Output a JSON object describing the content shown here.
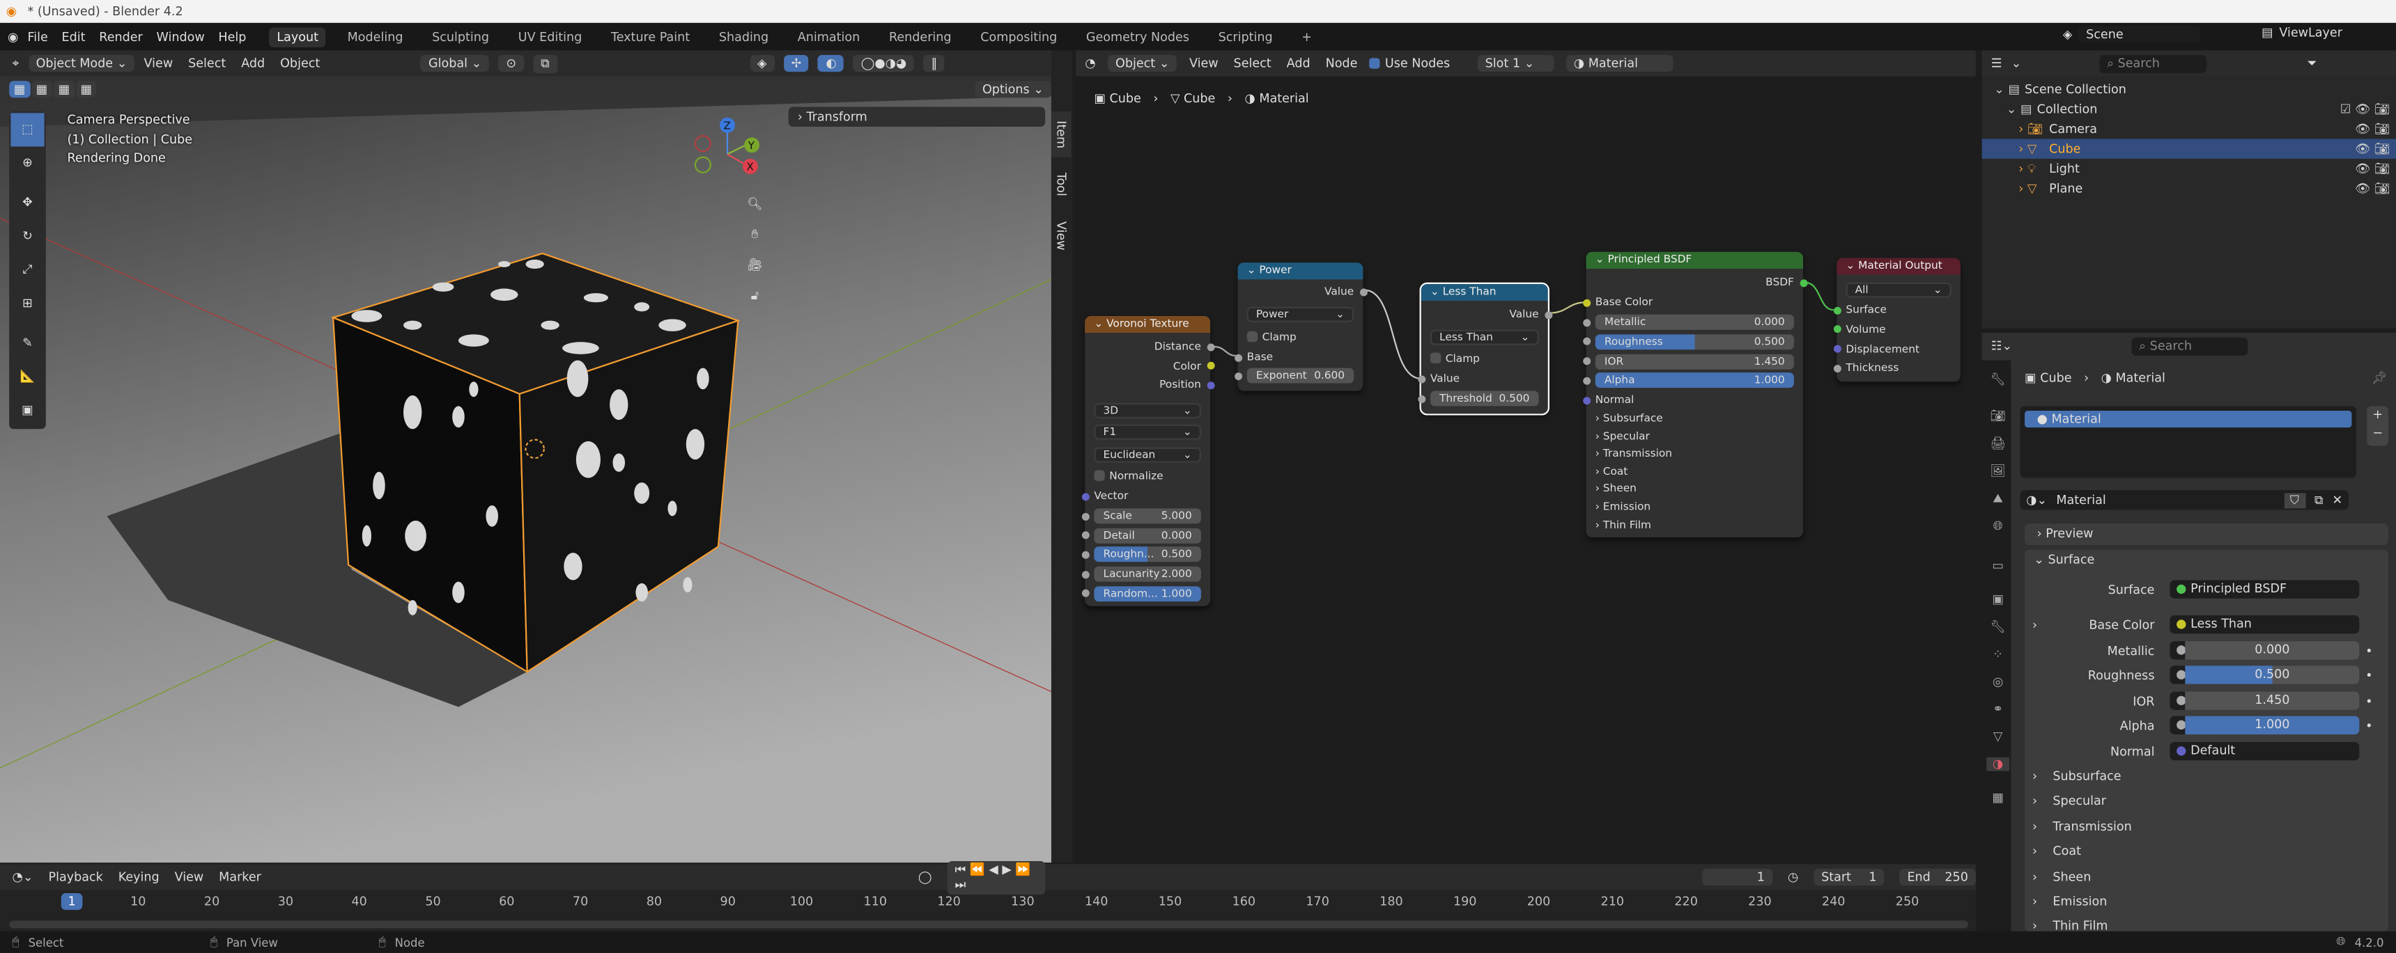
{
  "window": {
    "title": "* (Unsaved) - Blender 4.2"
  },
  "menu": [
    "File",
    "Edit",
    "Render",
    "Window",
    "Help"
  ],
  "workspaces": [
    "Layout",
    "Modeling",
    "Sculpting",
    "UV Editing",
    "Texture Paint",
    "Shading",
    "Animation",
    "Rendering",
    "Compositing",
    "Geometry Nodes",
    "Scripting",
    "+"
  ],
  "viewport": {
    "mode": "Object Mode",
    "menus": [
      "View",
      "Select",
      "Add",
      "Object"
    ],
    "orientation": "Global",
    "options": "Options",
    "info": [
      "Camera Perspective",
      "(1) Collection | Cube",
      "Rendering Done"
    ],
    "transform_panel": "Transform",
    "side_tabs": [
      "Item",
      "Tool",
      "View"
    ],
    "gizmo": {
      "z": "Z",
      "y": "Y",
      "x": "X"
    }
  },
  "node_editor": {
    "type": "Object",
    "menus": [
      "View",
      "Select",
      "Add",
      "Node"
    ],
    "use_nodes": "Use Nodes",
    "slot": "Slot 1",
    "material": "Material",
    "breadcrumb": [
      "Cube",
      "Cube",
      "Material"
    ]
  },
  "nodes": {
    "voronoi": {
      "title": "Voronoi Texture",
      "outputs": [
        "Distance",
        "Color",
        "Position"
      ],
      "dims": "3D",
      "feature": "F1",
      "metric": "Euclidean",
      "normalize": "Normalize",
      "vector": "Vector",
      "fields": [
        {
          "l": "Scale",
          "v": "5.000"
        },
        {
          "l": "Detail",
          "v": "0.000"
        },
        {
          "l": "Roughn...",
          "v": "0.500"
        },
        {
          "l": "Lacunarity",
          "v": "2.000"
        },
        {
          "l": "Random...",
          "v": "1.000"
        }
      ]
    },
    "power": {
      "title": "Power",
      "output": "Value",
      "op": "Power",
      "clamp": "Clamp",
      "base": "Base",
      "exponent_label": "Exponent",
      "exponent": "0.600"
    },
    "less_than": {
      "title": "Less Than",
      "output": "Value",
      "op": "Less Than",
      "clamp": "Clamp",
      "input": "Value",
      "threshold_label": "Threshold",
      "threshold": "0.500"
    },
    "bsdf": {
      "title": "Principled BSDF",
      "output": "BSDF",
      "base_color": "Base Color",
      "fields": [
        {
          "l": "Metallic",
          "v": "0.000",
          "f": 0
        },
        {
          "l": "Roughness",
          "v": "0.500",
          "f": 0.5
        },
        {
          "l": "IOR",
          "v": "1.450",
          "f": 0
        },
        {
          "l": "Alpha",
          "v": "1.000",
          "f": 1
        }
      ],
      "normal": "Normal",
      "panels": [
        "Subsurface",
        "Specular",
        "Transmission",
        "Coat",
        "Sheen",
        "Emission",
        "Thin Film"
      ]
    },
    "output": {
      "title": "Material Output",
      "target": "All",
      "inputs": [
        "Surface",
        "Volume",
        "Displacement",
        "Thickness"
      ]
    }
  },
  "outliner": {
    "scene": "Scene",
    "view_layer": "ViewLayer",
    "search_placeholder": "Search",
    "items": [
      {
        "label": "Scene Collection",
        "depth": 0
      },
      {
        "label": "Collection",
        "depth": 1
      },
      {
        "label": "Camera",
        "depth": 2
      },
      {
        "label": "Cube",
        "depth": 2,
        "selected": true
      },
      {
        "label": "Light",
        "depth": 2
      },
      {
        "label": "Plane",
        "depth": 2
      }
    ]
  },
  "properties": {
    "search_placeholder": "Search",
    "breadcrumb": [
      "Cube",
      "Material"
    ],
    "slot": "Material",
    "material_name": "Material",
    "preview": "Preview",
    "surface_panel": "Surface",
    "rows": [
      {
        "l": "Surface",
        "v": "Principled BSDF",
        "c": "#4fc34f"
      },
      {
        "l": "Base Color",
        "v": "Less Than",
        "c": "#c7c72a"
      }
    ],
    "values": [
      {
        "l": "Metallic",
        "v": "0.000",
        "f": 0
      },
      {
        "l": "Roughness",
        "v": "0.500",
        "f": 0.5
      },
      {
        "l": "IOR",
        "v": "1.450",
        "f": 0
      },
      {
        "l": "Alpha",
        "v": "1.000",
        "f": 1
      }
    ],
    "normal": {
      "l": "Normal",
      "v": "Default"
    },
    "panels": [
      "Subsurface",
      "Specular",
      "Transmission",
      "Coat",
      "Sheen",
      "Emission",
      "Thin Film"
    ]
  },
  "timeline": {
    "menus": [
      "Playback",
      "Keying",
      "View",
      "Marker"
    ],
    "current": "1",
    "start_label": "Start",
    "start": "1",
    "end_label": "End",
    "end": "250",
    "ticks": [
      "1",
      "10",
      "20",
      "30",
      "40",
      "50",
      "60",
      "70",
      "80",
      "90",
      "100",
      "110",
      "120",
      "130",
      "140",
      "150",
      "160",
      "170",
      "180",
      "190",
      "200",
      "210",
      "220",
      "230",
      "240",
      "250"
    ]
  },
  "status": {
    "select": "Select",
    "pan": "Pan View",
    "node": "Node",
    "version": "4.2.0"
  },
  "colors": {
    "accent": "#4772b3",
    "voronoi": "#7a4a1f",
    "converter": "#1e5a7d",
    "shader": "#2e6b2e",
    "output": "#5a1f2b",
    "cube_outline": "#f39c31"
  }
}
